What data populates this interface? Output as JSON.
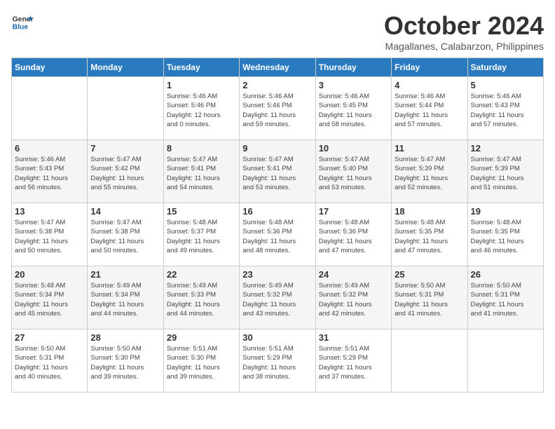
{
  "logo": {
    "line1": "General",
    "line2": "Blue"
  },
  "title": "October 2024",
  "location": "Magallanes, Calabarzon, Philippines",
  "days_of_week": [
    "Sunday",
    "Monday",
    "Tuesday",
    "Wednesday",
    "Thursday",
    "Friday",
    "Saturday"
  ],
  "weeks": [
    [
      {
        "day": "",
        "info": ""
      },
      {
        "day": "",
        "info": ""
      },
      {
        "day": "1",
        "info": "Sunrise: 5:46 AM\nSunset: 5:46 PM\nDaylight: 12 hours\nand 0 minutes."
      },
      {
        "day": "2",
        "info": "Sunrise: 5:46 AM\nSunset: 5:46 PM\nDaylight: 11 hours\nand 59 minutes."
      },
      {
        "day": "3",
        "info": "Sunrise: 5:46 AM\nSunset: 5:45 PM\nDaylight: 11 hours\nand 58 minutes."
      },
      {
        "day": "4",
        "info": "Sunrise: 5:46 AM\nSunset: 5:44 PM\nDaylight: 11 hours\nand 57 minutes."
      },
      {
        "day": "5",
        "info": "Sunrise: 5:46 AM\nSunset: 5:43 PM\nDaylight: 11 hours\nand 57 minutes."
      }
    ],
    [
      {
        "day": "6",
        "info": "Sunrise: 5:46 AM\nSunset: 5:43 PM\nDaylight: 11 hours\nand 56 minutes."
      },
      {
        "day": "7",
        "info": "Sunrise: 5:47 AM\nSunset: 5:42 PM\nDaylight: 11 hours\nand 55 minutes."
      },
      {
        "day": "8",
        "info": "Sunrise: 5:47 AM\nSunset: 5:41 PM\nDaylight: 11 hours\nand 54 minutes."
      },
      {
        "day": "9",
        "info": "Sunrise: 5:47 AM\nSunset: 5:41 PM\nDaylight: 11 hours\nand 53 minutes."
      },
      {
        "day": "10",
        "info": "Sunrise: 5:47 AM\nSunset: 5:40 PM\nDaylight: 11 hours\nand 53 minutes."
      },
      {
        "day": "11",
        "info": "Sunrise: 5:47 AM\nSunset: 5:39 PM\nDaylight: 11 hours\nand 52 minutes."
      },
      {
        "day": "12",
        "info": "Sunrise: 5:47 AM\nSunset: 5:39 PM\nDaylight: 11 hours\nand 51 minutes."
      }
    ],
    [
      {
        "day": "13",
        "info": "Sunrise: 5:47 AM\nSunset: 5:38 PM\nDaylight: 11 hours\nand 50 minutes."
      },
      {
        "day": "14",
        "info": "Sunrise: 5:47 AM\nSunset: 5:38 PM\nDaylight: 11 hours\nand 50 minutes."
      },
      {
        "day": "15",
        "info": "Sunrise: 5:48 AM\nSunset: 5:37 PM\nDaylight: 11 hours\nand 49 minutes."
      },
      {
        "day": "16",
        "info": "Sunrise: 5:48 AM\nSunset: 5:36 PM\nDaylight: 11 hours\nand 48 minutes."
      },
      {
        "day": "17",
        "info": "Sunrise: 5:48 AM\nSunset: 5:36 PM\nDaylight: 11 hours\nand 47 minutes."
      },
      {
        "day": "18",
        "info": "Sunrise: 5:48 AM\nSunset: 5:35 PM\nDaylight: 11 hours\nand 47 minutes."
      },
      {
        "day": "19",
        "info": "Sunrise: 5:48 AM\nSunset: 5:35 PM\nDaylight: 11 hours\nand 46 minutes."
      }
    ],
    [
      {
        "day": "20",
        "info": "Sunrise: 5:48 AM\nSunset: 5:34 PM\nDaylight: 11 hours\nand 45 minutes."
      },
      {
        "day": "21",
        "info": "Sunrise: 5:49 AM\nSunset: 5:34 PM\nDaylight: 11 hours\nand 44 minutes."
      },
      {
        "day": "22",
        "info": "Sunrise: 5:49 AM\nSunset: 5:33 PM\nDaylight: 11 hours\nand 44 minutes."
      },
      {
        "day": "23",
        "info": "Sunrise: 5:49 AM\nSunset: 5:32 PM\nDaylight: 11 hours\nand 43 minutes."
      },
      {
        "day": "24",
        "info": "Sunrise: 5:49 AM\nSunset: 5:32 PM\nDaylight: 11 hours\nand 42 minutes."
      },
      {
        "day": "25",
        "info": "Sunrise: 5:50 AM\nSunset: 5:31 PM\nDaylight: 11 hours\nand 41 minutes."
      },
      {
        "day": "26",
        "info": "Sunrise: 5:50 AM\nSunset: 5:31 PM\nDaylight: 11 hours\nand 41 minutes."
      }
    ],
    [
      {
        "day": "27",
        "info": "Sunrise: 5:50 AM\nSunset: 5:31 PM\nDaylight: 11 hours\nand 40 minutes."
      },
      {
        "day": "28",
        "info": "Sunrise: 5:50 AM\nSunset: 5:30 PM\nDaylight: 11 hours\nand 39 minutes."
      },
      {
        "day": "29",
        "info": "Sunrise: 5:51 AM\nSunset: 5:30 PM\nDaylight: 11 hours\nand 39 minutes."
      },
      {
        "day": "30",
        "info": "Sunrise: 5:51 AM\nSunset: 5:29 PM\nDaylight: 11 hours\nand 38 minutes."
      },
      {
        "day": "31",
        "info": "Sunrise: 5:51 AM\nSunset: 5:29 PM\nDaylight: 11 hours\nand 37 minutes."
      },
      {
        "day": "",
        "info": ""
      },
      {
        "day": "",
        "info": ""
      }
    ]
  ]
}
